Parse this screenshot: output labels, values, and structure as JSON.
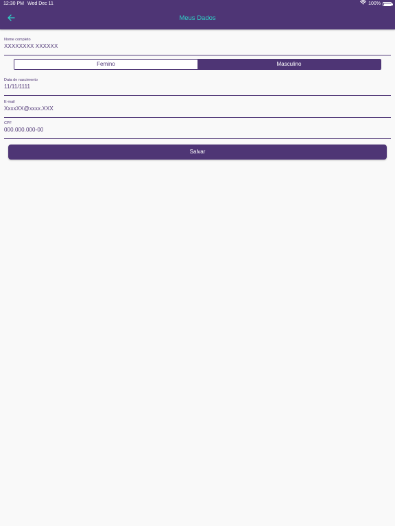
{
  "status_bar": {
    "time": "12:30 PM",
    "date": "Wed Dec 11",
    "battery": "100%",
    "wifi_icon": "wifi-icon",
    "battery_icon": "battery-icon"
  },
  "header": {
    "title": "Meus Dados",
    "back_icon": "arrow-left-icon"
  },
  "form": {
    "full_name": {
      "label": "Nome completo",
      "value": "XXXXXXXX XXXXXX"
    },
    "gender": {
      "options": [
        "Femino",
        "Masculino"
      ],
      "selected": "Masculino"
    },
    "birth_date": {
      "label": "Data de nascimento",
      "value": "11/11/1111"
    },
    "email": {
      "label": "E-mail",
      "value": "XxxxXX@xxxx.XXX"
    },
    "cpf": {
      "label": "CPF",
      "value": "000.000.000-00"
    }
  },
  "actions": {
    "save_label": "Salvar"
  },
  "colors": {
    "primary": "#4e3575",
    "accent": "#2fd0c6",
    "background": "#f9f9f9"
  }
}
